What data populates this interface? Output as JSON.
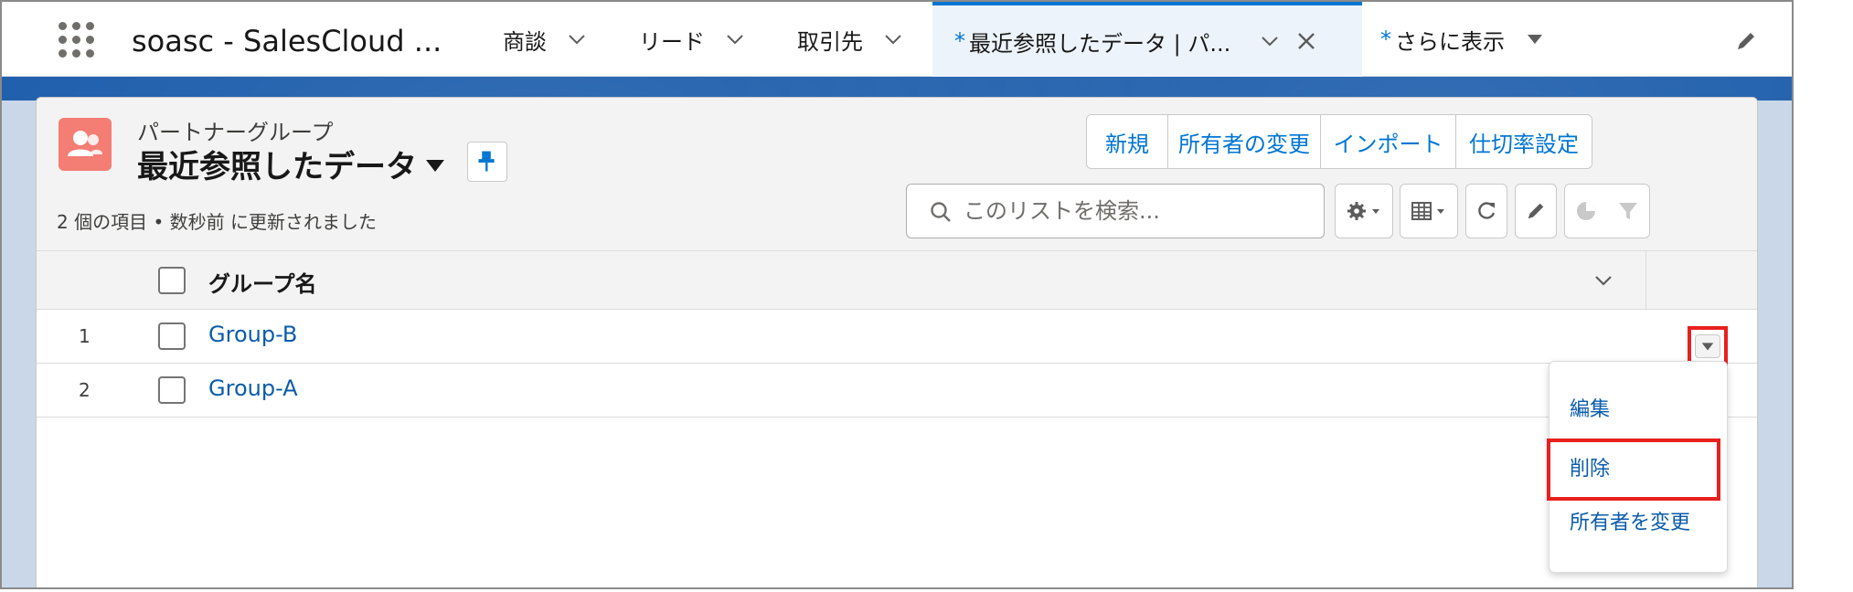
{
  "nav": {
    "app_name": "soasc - SalesCloud ...",
    "tabs": [
      {
        "label": "商談"
      },
      {
        "label": "リード"
      },
      {
        "label": "取引先"
      }
    ],
    "active_tab": {
      "star": "*",
      "label": "最近参照したデータ | パ..."
    },
    "more_tab": {
      "star": "*",
      "label": "さらに表示"
    },
    "icons": [
      "app-launcher-icon",
      "chevron-down-icon",
      "close-icon",
      "caret-down-icon",
      "edit-icon"
    ]
  },
  "list": {
    "object_label": "パートナーグループ",
    "title": "最近参照したデータ",
    "status": "2 個の項目 • 数秒前 に更新されました",
    "actions": [
      {
        "label": "新規"
      },
      {
        "label": "所有者の変更"
      },
      {
        "label": "インポート"
      },
      {
        "label": "仕切率設定"
      }
    ],
    "search": {
      "placeholder": "このリストを検索..."
    },
    "toolbar_icons": [
      "gear-icon",
      "table-icon",
      "refresh-icon",
      "edit-icon",
      "chart-icon",
      "filter-icon"
    ]
  },
  "table": {
    "column_header": "グループ名",
    "rows": [
      {
        "num": "1",
        "name": "Group-B"
      },
      {
        "num": "2",
        "name": "Group-A"
      }
    ]
  },
  "row_menu": {
    "items": [
      {
        "label": "編集"
      },
      {
        "label": "削除"
      },
      {
        "label": "所有者を変更"
      }
    ]
  },
  "colors": {
    "accent": "#0176d3",
    "link": "#0b5cab",
    "band": "#1b5cab",
    "object_icon": "#f47d74",
    "highlight": "#e8201e"
  }
}
